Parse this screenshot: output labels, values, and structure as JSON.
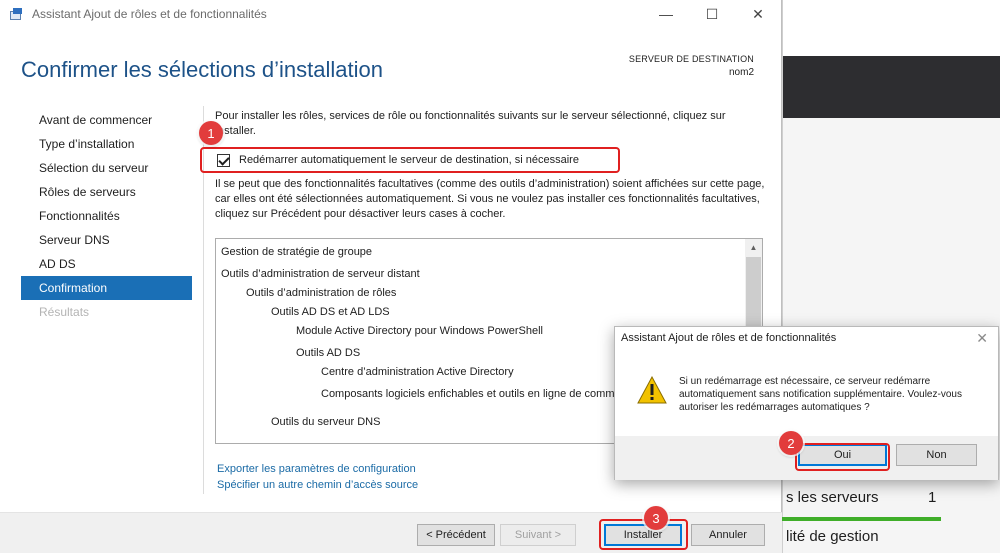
{
  "window": {
    "title": "Assistant Ajout de rôles et de fonctionnalités",
    "minimize": "—",
    "maximize": "☐",
    "close": "✕"
  },
  "header": {
    "page_title": "Confirmer les sélections d’installation",
    "dest_label": "SERVEUR DE DESTINATION",
    "dest_name": "nom2"
  },
  "nav": {
    "items": [
      {
        "label": "Avant de commencer",
        "state": "normal"
      },
      {
        "label": "Type d’installation",
        "state": "normal"
      },
      {
        "label": "Sélection du serveur",
        "state": "normal"
      },
      {
        "label": "Rôles de serveurs",
        "state": "normal"
      },
      {
        "label": "Fonctionnalités",
        "state": "normal"
      },
      {
        "label": "Serveur DNS",
        "state": "normal"
      },
      {
        "label": "AD DS",
        "state": "normal"
      },
      {
        "label": "Confirmation",
        "state": "active"
      },
      {
        "label": "Résultats",
        "state": "disabled"
      }
    ]
  },
  "content": {
    "intro": "Pour installer les rôles, services de rôle ou fonctionnalités suivants sur le serveur sélectionné, cliquez sur Installer.",
    "restart_checkbox": {
      "label": "Redémarrer automatiquement le serveur de destination, si nécessaire",
      "checked": true
    },
    "optional_note": "Il se peut que des fonctionnalités facultatives (comme des outils d’administration) soient affichées sur cette page, car elles ont été sélectionnées automatiquement. Si vous ne voulez pas installer ces fonctionnalités facultatives, cliquez sur Précédent pour désactiver leurs cases à cocher.",
    "features": [
      {
        "label": "Gestion de stratégie de groupe",
        "level": 0
      },
      {
        "label": "Outils d’administration de serveur distant",
        "level": 0
      },
      {
        "label": "Outils d’administration de rôles",
        "level": 1
      },
      {
        "label": "Outils AD DS et AD LDS",
        "level": 2
      },
      {
        "label": "Module Active Directory pour Windows PowerShell",
        "level": 3
      },
      {
        "label": "Outils AD DS",
        "level": 3
      },
      {
        "label": "Centre d’administration Active Directory",
        "level": 4
      },
      {
        "label": "Composants logiciels enfichables et outils en ligne de commande AD DS",
        "level": 4
      },
      {
        "label": "Outils du serveur DNS",
        "level": 2
      }
    ],
    "export_link": "Exporter les paramètres de configuration",
    "source_link": "Spécifier un autre chemin d’accès source"
  },
  "footer": {
    "prev_label": "< Précédent",
    "next_label": "Suivant >",
    "install_label": "Installer",
    "cancel_label": "Annuler"
  },
  "dialog": {
    "title": "Assistant Ajout de rôles et de fonctionnalités",
    "close": "✕",
    "message": "Si un redémarrage est nécessaire, ce serveur redémarre automatiquement sans notification supplémentaire. Voulez-vous autoriser les redémarrages automatiques ?",
    "yes_label": "Oui",
    "no_label": "Non"
  },
  "background": {
    "servers_label": "s les serveurs",
    "servers_count": "1",
    "management_label": "lité de gestion"
  },
  "annotations": {
    "step1": "1",
    "step2": "2",
    "step3": "3",
    "highlight_color": "#e02020"
  },
  "colors": {
    "accent": "#1a6fb6",
    "title_blue": "#1d5288",
    "link": "#1b6ba6",
    "status_green": "#3fae29"
  }
}
